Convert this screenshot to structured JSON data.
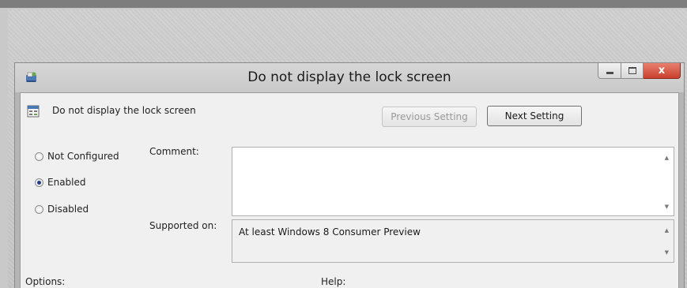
{
  "window": {
    "title": "Do not display the lock screen",
    "controls": {
      "close_glyph": "x"
    }
  },
  "header": {
    "setting_name": "Do not display the lock screen",
    "previous_label": "Previous Setting",
    "next_label": "Next Setting"
  },
  "state": {
    "options": [
      {
        "label": "Not Configured",
        "selected": false
      },
      {
        "label": "Enabled",
        "selected": true
      },
      {
        "label": "Disabled",
        "selected": false
      }
    ]
  },
  "fields": {
    "comment_label": "Comment:",
    "comment_value": "",
    "supported_label": "Supported on:",
    "supported_value": "At least Windows 8 Consumer Preview"
  },
  "sections": {
    "options_label": "Options:",
    "help_label": "Help:"
  },
  "colors": {
    "close_button": "#c9402d",
    "radio_selected": "#233f8a",
    "disabled_text": "#9a9a9a"
  }
}
